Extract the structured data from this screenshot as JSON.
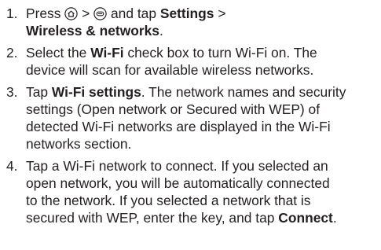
{
  "steps": [
    {
      "number": "1.",
      "parts": {
        "pre": "Press",
        "gt1": ">",
        "mid": "and tap",
        "settings": "Settings",
        "gt2": ">",
        "wireless": "Wireless & networks",
        "end": "."
      },
      "icons": [
        "home-icon",
        "menu-icon"
      ]
    },
    {
      "number": "2.",
      "parts": {
        "pre": "Select the",
        "wifi": "Wi-Fi",
        "post1": "check box to turn Wi-Fi on. The",
        "line2": "device will scan for available wireless networks."
      }
    },
    {
      "number": "3.",
      "parts": {
        "pre": "Tap",
        "wifi_settings": "Wi-Fi settings",
        "post1": ". The network names and security",
        "line2": "settings (Open network or Secured with WEP) of",
        "line3": "detected Wi-Fi networks are displayed in the Wi-Fi",
        "line4": "networks section."
      }
    },
    {
      "number": "4.",
      "parts": {
        "line1": "Tap a Wi-Fi network to connect. If you selected an",
        "line2": "open network, you will be automatically connected",
        "line3": "to the network. If you selected a network that is",
        "line4_pre": "secured with WEP, enter the key, and tap",
        "connect": "Connect",
        "end": "."
      }
    }
  ],
  "colors": {
    "text": "#231f20",
    "background": "#ffffff"
  }
}
